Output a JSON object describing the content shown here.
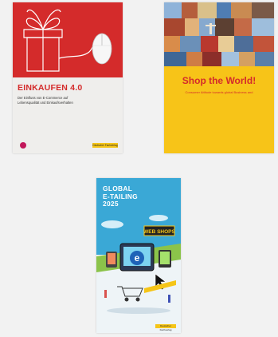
{
  "books": [
    {
      "title": "EINKAUFEN 4.0",
      "subtitle": "Der Einfluss von E-Commerce auf Lebensqualität und Einkaufsverhalten",
      "publisher": "Deutscher Fachverlag",
      "cover_colors": {
        "top": "#d42b2b",
        "bottom": "#efeeec",
        "accent": "#f5c518"
      }
    },
    {
      "title": "Shop the World!",
      "subtitle": "Consumer Attitude towards global Business and",
      "cover_colors": {
        "top": "#5d89b8",
        "bottom": "#f7c418",
        "title": "#d42b2b"
      }
    },
    {
      "title_line1": "GLOBAL",
      "title_line2": "E-TAILING",
      "title_line3": "2025",
      "sign_text": "WEB SHOPS",
      "publisher": "Deutscher Fachverlag",
      "cover_colors": {
        "top": "#3aa8d6",
        "bottom": "#eef4f7",
        "accent": "#f5c518"
      }
    }
  ]
}
